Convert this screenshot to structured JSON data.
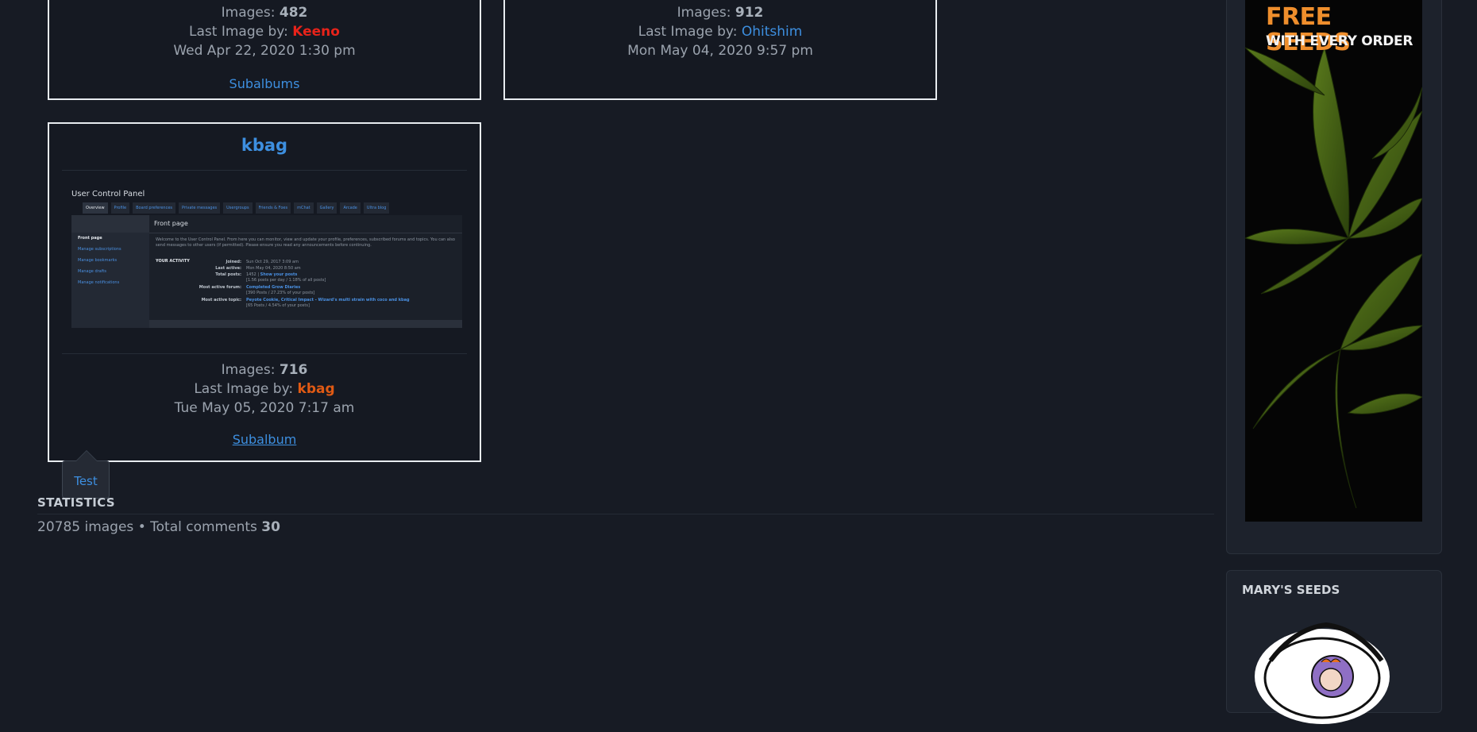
{
  "albums": [
    {
      "images_label": "Images: ",
      "images_count": "482",
      "last_label": "Last Image by: ",
      "last_user": "Keeno",
      "last_user_color": "#e8231a",
      "date": "Wed Apr 22, 2020 1:30 pm",
      "link": "Subalbums"
    },
    {
      "images_label": "Images: ",
      "images_count": "912",
      "last_label": "Last Image by: ",
      "last_user": "Ohitshim",
      "last_user_color": "#3d8fe0",
      "date": "Mon May 04, 2020 9:57 pm"
    },
    {
      "title": "kbag",
      "images_label": "Images: ",
      "images_count": "716",
      "last_label": "Last Image by: ",
      "last_user": "kbag",
      "last_user_color": "#e05a14",
      "date": "Tue May 05, 2020 7:17 am",
      "link": "Subalbum",
      "thumbnail": {
        "heading": "User Control Panel",
        "tabs": [
          "Overview",
          "Profile",
          "Board preferences",
          "Private messages",
          "Usergroups",
          "Friends & Foes",
          "mChat",
          "Gallery",
          "Arcade",
          "Ultra blog"
        ],
        "menu": [
          "Front page",
          "Manage subscriptions",
          "Manage bookmarks",
          "Manage drafts",
          "Manage notifications"
        ],
        "panel_title": "Front page",
        "intro": "Welcome to the User Control Panel. From here you can monitor, view and update your profile, preferences, subscribed forums and topics. You can also send messages to other users (if permitted). Please ensure you read any announcements before continuing.",
        "activity_heading": "YOUR ACTIVITY",
        "rows": [
          {
            "key": "Joined:",
            "value": "Sun Oct 29, 2017 3:09 am"
          },
          {
            "key": "Last active:",
            "value": "Mon May 04, 2020 8:50 am"
          },
          {
            "key": "Total posts:",
            "value": "1452 | ",
            "link": "Show your posts",
            "value2": "[1.56 posts per day / 1.18% of all posts]"
          },
          {
            "key": "Most active forum:",
            "link": "Completed Grow Diaries",
            "value2": "[390 Posts / 27.23% of your posts]"
          },
          {
            "key": "Most active topic:",
            "link": "Peyote Cookie, Critical Impact - Wizard's multi strain with coco and kbag",
            "value2": "[65 Posts / 4.54% of your posts]"
          }
        ]
      }
    }
  ],
  "tooltip": {
    "text": "Test"
  },
  "statistics": {
    "title": "STATISTICS",
    "images": "20785 images",
    "separator": " • ",
    "comments_label": "Total comments ",
    "comments_count": "30"
  },
  "sidebar": {
    "ad": {
      "headline": "FREE SEEDS",
      "subline": "WITH EVERY ORDER"
    },
    "panel2_title": "MARY'S SEEDS"
  }
}
